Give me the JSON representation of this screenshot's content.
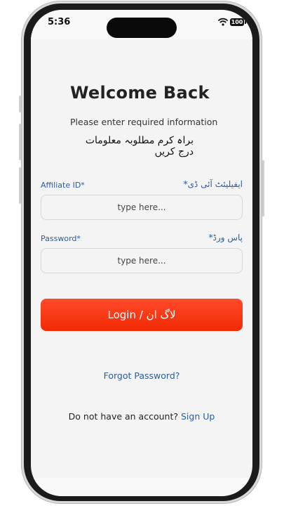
{
  "status_bar": {
    "time": "5:36",
    "battery": "100"
  },
  "login": {
    "title": "Welcome Back",
    "subtitle": "Please enter required information",
    "subtitle_ur": "براہ کرم مطلوبہ معلومات درج کریں",
    "affiliate_label": "Affiliate ID*",
    "affiliate_label_ur": "ایفیلیئٹ آئی ڈی*",
    "affiliate_placeholder": "type here...",
    "password_label": "Password*",
    "password_label_ur": "پاس ورڈ*",
    "password_placeholder": "type here...",
    "login_button": "Login / لاگ ان",
    "forgot_password": "Forgot Password?",
    "no_account_text": "Do not have an account?",
    "signup_link": "Sign Up"
  },
  "colors": {
    "accent_blue": "#2a5d9f",
    "button_red": "#f22a05",
    "background": "#f4f4f4"
  }
}
